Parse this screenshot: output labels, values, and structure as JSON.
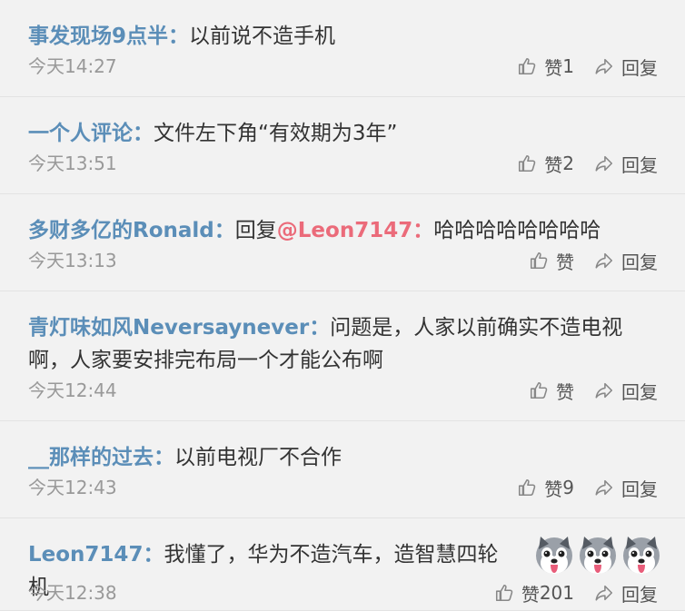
{
  "comments": [
    {
      "user": "事发现场9点半",
      "separator": "：",
      "text": "以前说不造手机",
      "time": "今天14:27",
      "like_label": "赞",
      "like_count": "1",
      "reply_label": "回复"
    },
    {
      "user": "一个人评论",
      "separator": "：",
      "text": "文件左下角“有效期为3年”",
      "time": "今天13:51",
      "like_label": "赞",
      "like_count": "2",
      "reply_label": "回复"
    },
    {
      "user": "多财多亿的Ronald",
      "separator": "：",
      "reply_prefix": "回复",
      "mention": "@Leon7147",
      "mention_separator": "：",
      "text": "哈哈哈哈哈哈哈哈",
      "time": "今天13:13",
      "like_label": "赞",
      "like_count": "",
      "reply_label": "回复"
    },
    {
      "user": "青灯味如风Neversaynever",
      "separator": "：",
      "text": "问题是，人家以前确实不造电视啊，人家要安排完布局一个才能公布啊",
      "time": "今天12:44",
      "like_label": "赞",
      "like_count": "",
      "reply_label": "回复"
    },
    {
      "user": "__那样的过去",
      "separator": "：",
      "text": "以前电视厂不合作",
      "time": "今天12:43",
      "like_label": "赞",
      "like_count": "9",
      "reply_label": "回复"
    },
    {
      "user": "Leon7147",
      "separator": "：",
      "text": "我懂了，华为不造汽车，造智慧四轮机",
      "emoji_icon": "husky-dog-face-emoji",
      "emoji_count": 3,
      "time": "今天12:38",
      "like_label": "赞",
      "like_count": "201",
      "reply_label": "回复"
    }
  ],
  "colors": {
    "background": "#f2f2f2",
    "username": "#5b8eb8",
    "mention": "#eb6b7a",
    "text": "#333333",
    "time": "#999999",
    "action": "#555555"
  }
}
